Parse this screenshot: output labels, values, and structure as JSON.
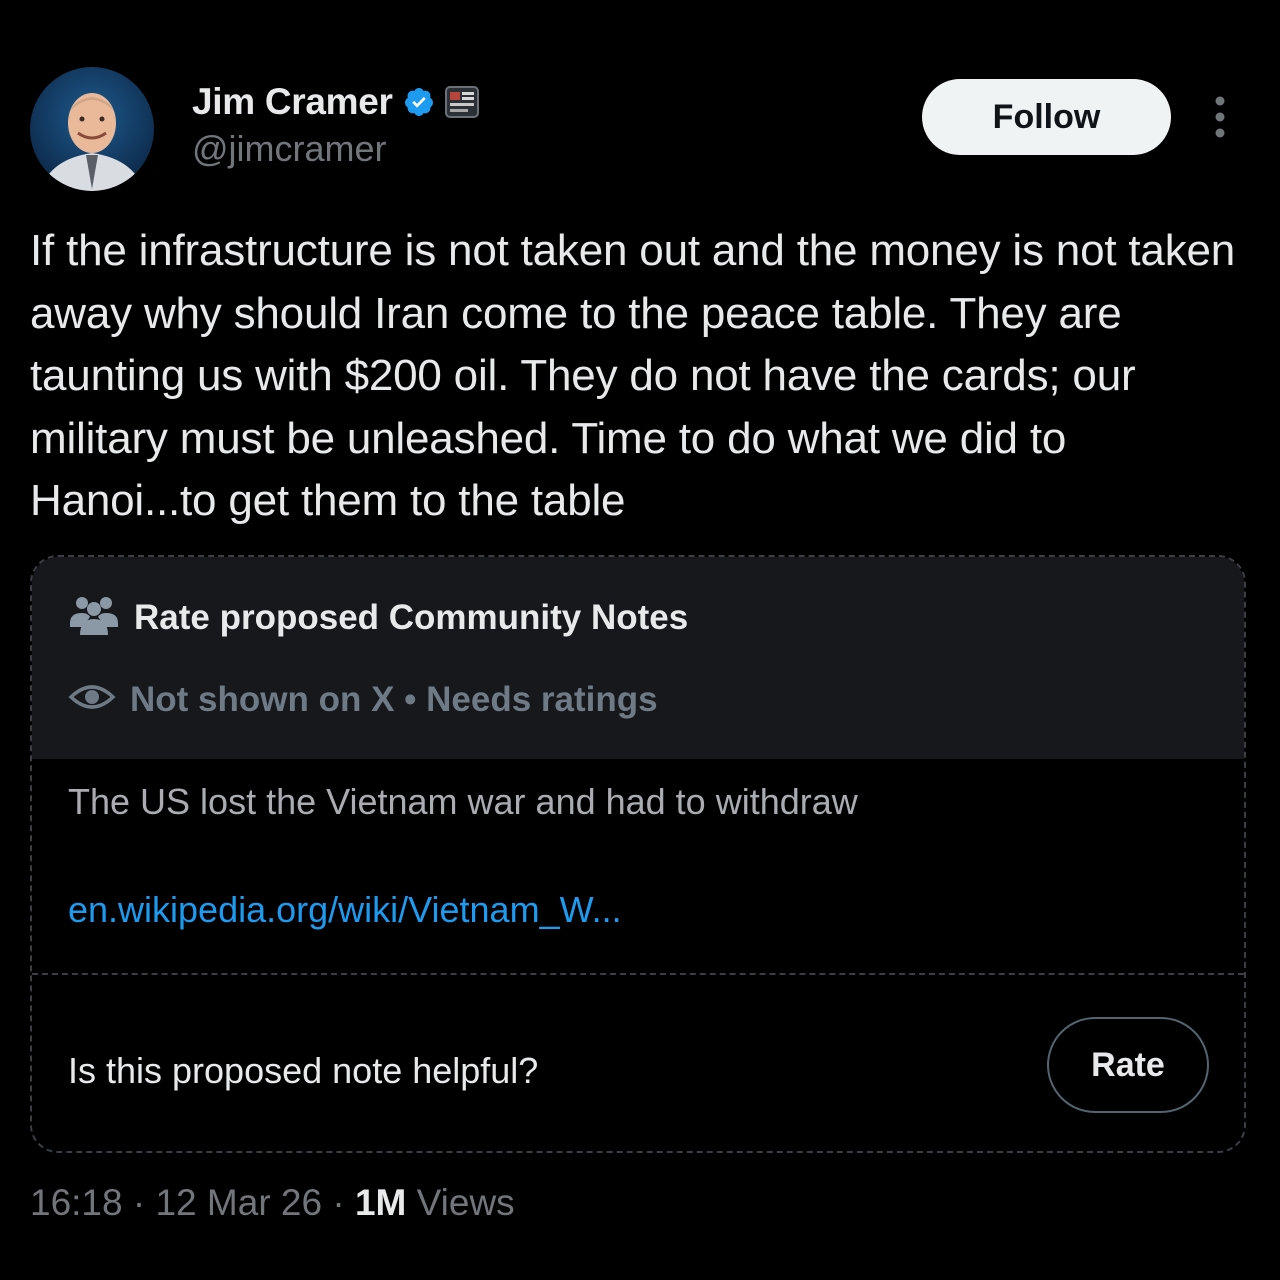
{
  "author": {
    "display_name": "Jim Cramer",
    "handle": "@jimcramer",
    "verified": true,
    "verified_icon": "verified-badge-icon",
    "affiliate_icon": "affiliate-badge-icon"
  },
  "follow_label": "Follow",
  "more_icon": "more-vertical-icon",
  "tweet_text": "If the infrastructure is not taken out and the money is not taken away why should Iran come to the peace table. They are taunting us with $200 oil. They do not have the cards; our military must be unleashed. Time to do what we did to Hanoi...to get them to the table",
  "community_note": {
    "title": "Rate proposed Community Notes",
    "title_icon": "people-icon",
    "status": "Not shown on X • Needs ratings",
    "status_icon": "eye-icon",
    "body": "The US lost the Vietnam war and had to withdraw",
    "link_text": "en.wikipedia.org/wiki/Vietnam_W...",
    "question": "Is this proposed note helpful?",
    "rate_label": "Rate"
  },
  "meta": {
    "time": "16:18",
    "separator": "·",
    "date": "12 Mar 26",
    "views_count": "1M",
    "views_label": "Views"
  },
  "colors": {
    "background": "#000000",
    "primary_text": "#e7e9ea",
    "secondary_text": "#71767b",
    "link": "#1d9bf0",
    "verified": "#1d9bf0",
    "note_header_bg": "#16181c"
  }
}
